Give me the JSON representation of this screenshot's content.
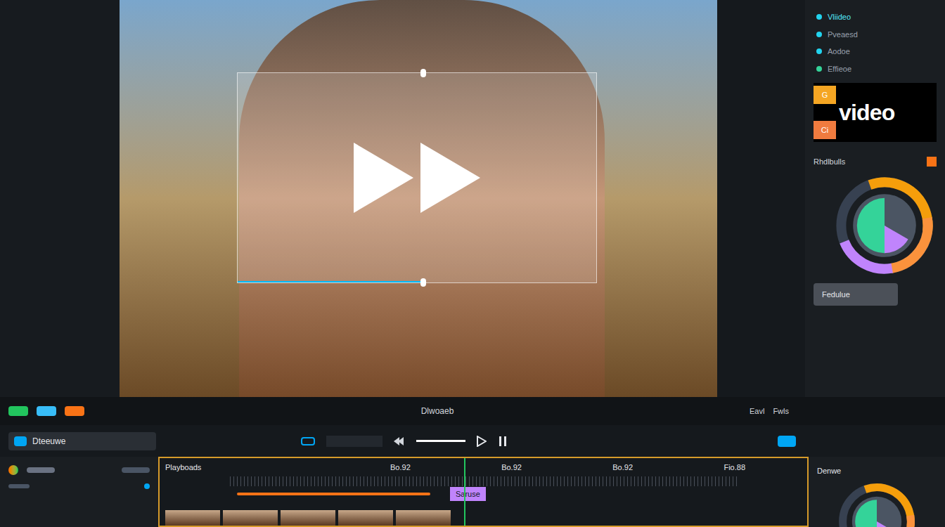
{
  "left_markers": [
    {
      "color": "#22c55e"
    },
    {
      "color": "#38bdf8"
    },
    {
      "color": "#f97316"
    }
  ],
  "preview": {
    "caption": "Dlwoaeb"
  },
  "right_panel": {
    "items": [
      {
        "label": "Vliideo",
        "color": "#22d3ee",
        "selected": true
      },
      {
        "label": "Pveaesd",
        "color": "#22d3ee",
        "selected": false
      },
      {
        "label": "Aodoe",
        "color": "#22d3ee",
        "selected": false
      },
      {
        "label": "Effieoe",
        "color": "#34d399",
        "selected": false
      }
    ],
    "logo": {
      "text": "video",
      "badges": [
        "G",
        "Ci"
      ]
    },
    "section": "Rhdlbulls",
    "button": "Fedulue"
  },
  "status_labels": [
    "Eavl",
    "Fwls"
  ],
  "source_chip": "Dteeuwe",
  "timeline": {
    "title": "Playboads",
    "ticks": [
      "Bo.92",
      "Bo.92",
      "Bo.92",
      "Fio.88"
    ],
    "clip": "Saruse",
    "playhead": 0.47
  },
  "effects_panel": {
    "title": "Denwe"
  }
}
